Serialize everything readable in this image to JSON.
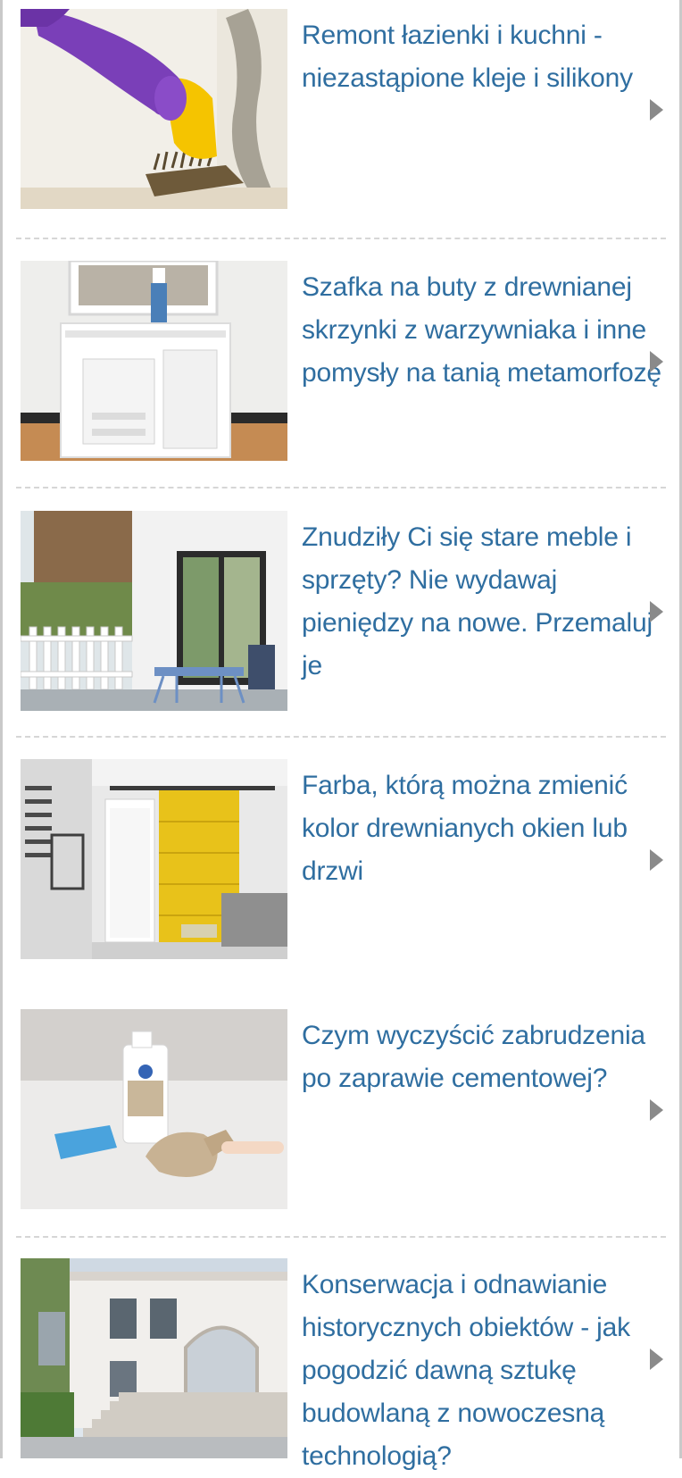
{
  "articles": [
    {
      "title": "Remont łazienki i kuchni - niezastąpione kleje i silikony",
      "image": "mold-cleaning-photo"
    },
    {
      "title": "Szafka na buty z drewnianej skrzynki z warzywniaka i inne pomysły na tanią metamorfozę",
      "image": "white-crate-cabinet-photo"
    },
    {
      "title": "Znudziły Ci się stare meble i sprzęty? Nie wydawaj pieniędzy na nowe. Przemaluj je",
      "image": "terrace-furniture-photo"
    },
    {
      "title": "Farba, którą można zmienić kolor drewnianych okien lub drzwi",
      "image": "yellow-sliding-door-photo"
    },
    {
      "title": "Czym wyczyścić zabrudzenia po zaprawie cementowej?",
      "image": "cleaning-products-photo"
    },
    {
      "title": "Konserwacja i odnawianie historycznych obiektów - jak pogodzić dawną sztukę budowlaną z nowoczesną technologią?",
      "image": "historic-building-photo"
    }
  ],
  "colors": {
    "title_link": "#2f6ea0",
    "arrow": "#8a8a8a",
    "separator": "#d6d6d6",
    "frame_border": "#c9c9c9"
  },
  "icons": {
    "item_arrow": "right-triangle-arrow-icon"
  }
}
